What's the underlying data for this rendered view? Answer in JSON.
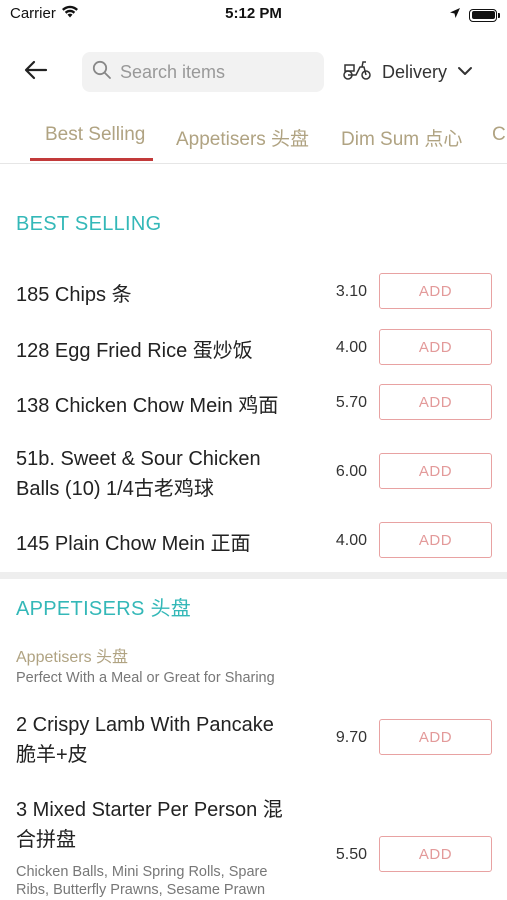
{
  "status_bar": {
    "carrier": "Carrier",
    "time": "5:12 PM"
  },
  "header": {
    "search_placeholder": "Search items",
    "delivery_label": "Delivery"
  },
  "tabs": [
    {
      "label": "Best Selling",
      "active": true
    },
    {
      "label": "Appetisers 头盘",
      "active": false
    },
    {
      "label": "Dim Sum 点心",
      "active": false
    },
    {
      "label": "Ch",
      "active": false
    }
  ],
  "sections": {
    "best_selling": {
      "title": "BEST SELLING",
      "items": [
        {
          "name": "185 Chips 条",
          "price": "3.10",
          "button": "ADD"
        },
        {
          "name": "128 Egg Fried Rice 蛋炒饭",
          "price": "4.00",
          "button": "ADD"
        },
        {
          "name": "138 Chicken Chow Mein 鸡面",
          "price": "5.70",
          "button": "ADD"
        },
        {
          "name_line1": "51b. Sweet & Sour Chicken",
          "name_line2": "Balls (10) 1/4古老鸡球",
          "price": "6.00",
          "button": "ADD"
        },
        {
          "name": "145 Plain Chow Mein 正面",
          "price": "4.00",
          "button": "ADD"
        }
      ]
    },
    "appetisers": {
      "title": "APPETISERS 头盘",
      "subcategory": "Appetisers 头盘",
      "subcategory_desc": "Perfect With a Meal or Great for Sharing",
      "items": [
        {
          "name_line1": "2 Crispy Lamb With Pancake",
          "name_line2": "脆羊+皮",
          "price": "9.70",
          "button": "ADD"
        },
        {
          "name_line1": "3 Mixed Starter Per Person 混",
          "name_line2": "合拼盘",
          "desc_line1": "Chicken Balls, Mini Spring Rolls, Spare",
          "desc_line2": "Ribs, Butterfly Prawns, Sesame Prawn",
          "price": "5.50",
          "button": "ADD"
        }
      ]
    }
  },
  "colors": {
    "accent_teal": "#34b8b8",
    "tab_text": "#b0a382",
    "tab_underline": "#c23a3a",
    "add_button": "#e39a9a"
  },
  "icons": [
    "wifi-icon",
    "location-arrow-icon",
    "battery-icon",
    "back-arrow-icon",
    "search-icon",
    "scooter-icon",
    "chevron-down-icon"
  ]
}
